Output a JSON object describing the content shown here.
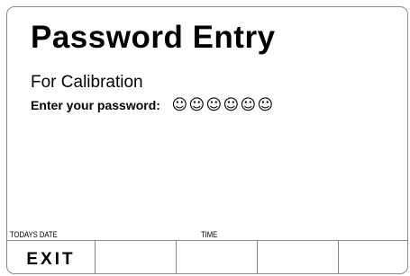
{
  "screen": {
    "title": "Password Entry",
    "subtitle": "For Calibration",
    "prompt_label": "Enter your password:",
    "password_mask": [
      "☺",
      "☺",
      "☺",
      "☺",
      "☺",
      "☺"
    ]
  },
  "status_bar": {
    "date_label": "TODAYS DATE",
    "time_label": "TIME"
  },
  "softkeys": [
    {
      "label": "EXIT"
    },
    {
      "label": ""
    },
    {
      "label": ""
    },
    {
      "label": ""
    },
    {
      "label": ""
    }
  ]
}
